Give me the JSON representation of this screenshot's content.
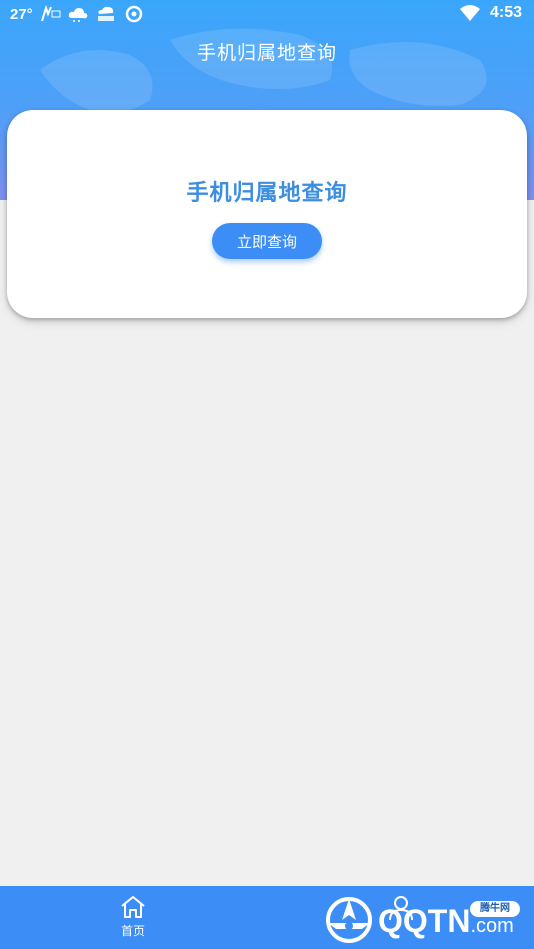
{
  "status_bar": {
    "temperature": "27°",
    "time": "4:53",
    "icons": [
      "news-app-icon",
      "cloud-icon",
      "rain-cloud-icon",
      "weibo-icon",
      "wifi-icon",
      "battery-icon"
    ]
  },
  "header": {
    "title": "手机归属地查询"
  },
  "card": {
    "title": "手机归属地查询",
    "button_label": "立即查询"
  },
  "bottom_nav": {
    "items": [
      {
        "label": "首页",
        "icon": "home-icon"
      },
      {
        "label": "",
        "icon": "user-icon"
      }
    ]
  },
  "watermark": {
    "brand_main": "QQTN",
    "brand_suffix": ".com",
    "badge": "腾牛网"
  },
  "colors": {
    "primary": "#3c8df5",
    "card_title": "#3b8ee0",
    "background": "#f0f0f0"
  }
}
